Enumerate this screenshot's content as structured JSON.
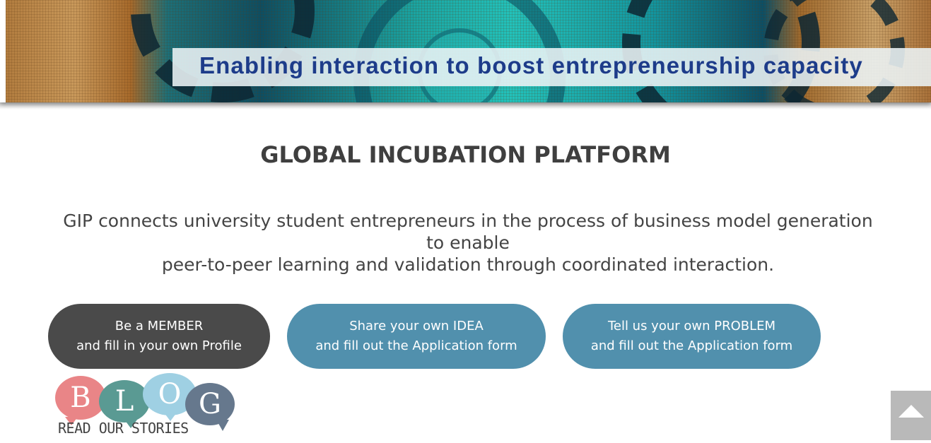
{
  "banner": {
    "tagline": "Enabling interaction to boost entrepreneurship capacity"
  },
  "main": {
    "title": "GLOBAL INCUBATION PLATFORM",
    "description_lines": [
      "GIP connects university student entrepreneurs in the process of business model generation",
      "to enable",
      "peer-to-peer learning and validation through coordinated interaction."
    ]
  },
  "actions": [
    {
      "line1": "Be a MEMBER",
      "line2": "and fill in your own Profile",
      "color": "#4a4a4a"
    },
    {
      "line1": "Share your own IDEA",
      "line2": "and fill out the Application form",
      "color": "#5190ad"
    },
    {
      "line1": "Tell us your own PROBLEM",
      "line2": "and fill out the Application form",
      "color": "#5190ad"
    }
  ],
  "blog": {
    "letters": [
      "B",
      "L",
      "O",
      "G"
    ],
    "caption": "READ OUR STORIES",
    "bubble_colors": [
      "#e98587",
      "#5a9a93",
      "#9fd0e3",
      "#66788d"
    ]
  },
  "back_to_top": {
    "icon": "arrow-up-icon"
  }
}
